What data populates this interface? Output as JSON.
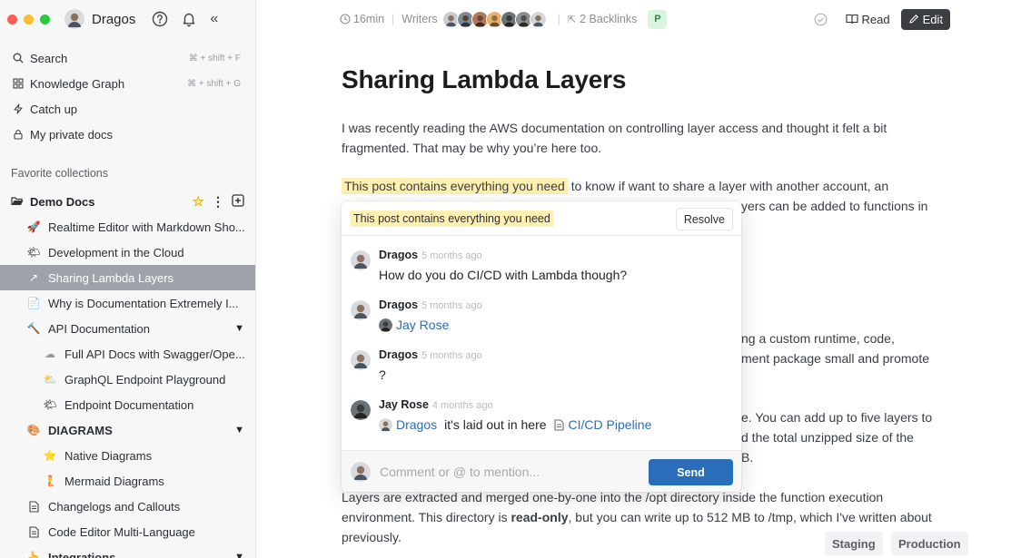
{
  "sidebar": {
    "workspace_name": "Dragos",
    "search": {
      "label": "Search",
      "shortcut": "⌘ + shift + F"
    },
    "knowledge_graph": {
      "label": "Knowledge Graph",
      "shortcut": "⌘ + shift + G"
    },
    "catch_up": {
      "label": "Catch up"
    },
    "private_docs": {
      "label": "My private docs"
    },
    "favorites_label": "Favorite collections",
    "collection": {
      "name": "Demo Docs"
    },
    "docs": [
      {
        "label": "Realtime Editor with Markdown Sho...",
        "emoji": "🚀"
      },
      {
        "label": "Development in the Cloud",
        "emoji": "🌤"
      },
      {
        "label": "Sharing Lambda Layers",
        "emoji": "↗"
      },
      {
        "label": "Why is Documentation Extremely I...",
        "emoji": "📄"
      },
      {
        "label": "API Documentation",
        "emoji": "🔨"
      },
      {
        "label": "Full API Docs with Swagger/Ope...",
        "emoji": "☁"
      },
      {
        "label": "GraphQL Endpoint Playground",
        "emoji": "⛅"
      },
      {
        "label": "Endpoint Documentation",
        "emoji": "🌤"
      },
      {
        "label": "DIAGRAMS",
        "emoji": "🎨"
      },
      {
        "label": "Native Diagrams",
        "emoji": "⭐"
      },
      {
        "label": "Mermaid Diagrams",
        "emoji": "🧜"
      },
      {
        "label": "Changelogs and Callouts",
        "emoji": "🗎"
      },
      {
        "label": "Code Editor Multi-Language",
        "emoji": "🗎"
      },
      {
        "label": "Integrations",
        "emoji": "👆"
      }
    ]
  },
  "topbar": {
    "read_time": "16min",
    "writers_label": "Writers",
    "backlinks": "2 Backlinks",
    "badge": "P",
    "read_label": "Read",
    "edit_label": "Edit"
  },
  "document": {
    "title": "Sharing Lambda Layers",
    "p1": "I was recently reading the AWS documentation on controlling layer access and thought it felt a bit fragmented. That may be why you’re here too.",
    "p2_highlight": "This post contains everything you need",
    "p2_rest_a": " to know if want to share a layer with another account, an",
    "p2_rest_b": "yers can be added to functions in",
    "p3a": "ng a custom runtime, code,",
    "p3b": "ment package small and promote",
    "p4a": "e. You can add up to five layers to",
    "p4b": "d the total unzipped size of the",
    "p4c": "B.",
    "p5_a": "Layers are extracted and merged one-by-one into the /opt directory inside the function execution environment. This directory is ",
    "p5_bold": "read-only",
    "p5_b": ", but you can write up to 512 MB to /tmp, which I've written about previously."
  },
  "comment_popover": {
    "quote": "This post contains everything you need",
    "resolve_label": "Resolve",
    "comments": [
      {
        "author": "Dragos",
        "time": "5 months ago",
        "text": "How do you do CI/CD with Lambda though?"
      },
      {
        "author": "Dragos",
        "time": "5 months ago",
        "mention": "Jay Rose"
      },
      {
        "author": "Dragos",
        "time": "5 months ago",
        "text": "?"
      },
      {
        "author": "Jay Rose",
        "time": "4 months ago",
        "mention": "Dragos",
        "text": "it's laid out in here",
        "doc_link": "CI/CD Pipeline"
      }
    ],
    "input_placeholder": "Comment or @ to mention...",
    "send_label": "Send"
  },
  "env_tags": [
    "Staging",
    "Production"
  ]
}
